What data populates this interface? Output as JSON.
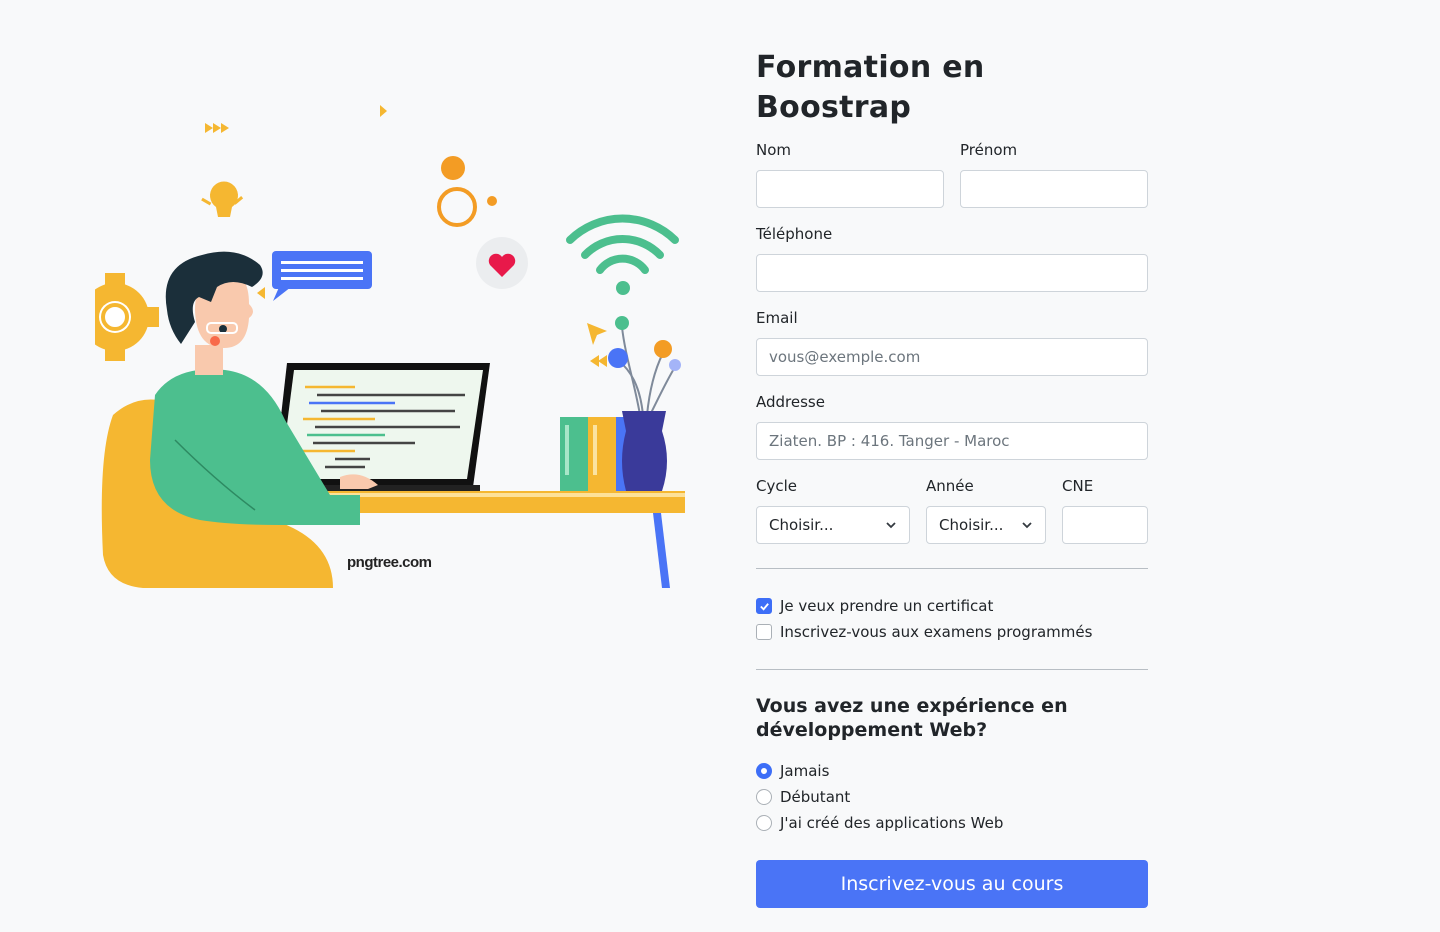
{
  "form": {
    "title": "Formation en Boostrap",
    "nom_label": "Nom",
    "prenom_label": "Prénom",
    "telephone_label": "Téléphone",
    "email_label": "Email",
    "email_placeholder": "vous@exemple.com",
    "address_label": "Addresse",
    "address_placeholder": "Ziaten. BP : 416. Tanger - Maroc",
    "cycle_label": "Cycle",
    "cycle_value": "Choisir...",
    "annee_label": "Année",
    "annee_value": "Choisir...",
    "cne_label": "CNE",
    "checkboxes": [
      {
        "label": "Je veux prendre un certificat",
        "checked": true
      },
      {
        "label": "Inscrivez-vous aux examens programmés",
        "checked": false
      }
    ],
    "experience_title": "Vous avez une expérience en développement Web?",
    "radios": [
      {
        "label": "Jamais",
        "checked": true
      },
      {
        "label": "Débutant",
        "checked": false
      },
      {
        "label": "J'ai créé des applications Web",
        "checked": false
      }
    ],
    "submit_label": "Inscrivez-vous au cours"
  },
  "illustration": {
    "watermark": "pngtree.com"
  },
  "colors": {
    "primary": "#4a74f6",
    "background": "#f8f9fa"
  }
}
